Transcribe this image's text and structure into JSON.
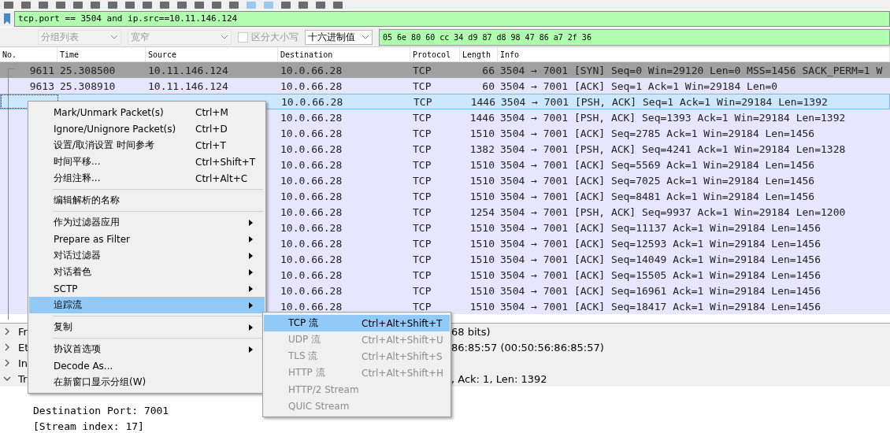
{
  "filter_bar": {
    "value": "tcp.port == 3504 and ip.src==10.11.146.124"
  },
  "search_bar": {
    "scope": {
      "value": "分组列表",
      "disabled": true
    },
    "charset": {
      "value": "宽窄",
      "disabled": true
    },
    "case_sensitive": {
      "label": "区分大小写",
      "checked": false,
      "disabled": true
    },
    "search_type": {
      "value": "十六进制值",
      "disabled": false
    },
    "query": {
      "value": "05 6e 80 60 cc 34 d9 87 d8 98 47 86 a7 2f 36"
    }
  },
  "packet_list": {
    "columns": [
      "No.",
      "Time",
      "Source",
      "Destination",
      "Protocol",
      "Length",
      "Info"
    ],
    "rows": [
      {
        "no": "9611",
        "time": "25.308500",
        "source": "10.11.146.124",
        "destination": "10.0.66.28",
        "protocol": "TCP",
        "length": "66",
        "info": "3504 → 7001 [SYN] Seq=0 Win=29120 Len=0 MSS=1456 SACK_PERM=1 W",
        "color": "#a0a0a0",
        "selected": false
      },
      {
        "no": "9613",
        "time": "25.308910",
        "source": "10.11.146.124",
        "destination": "10.0.66.28",
        "protocol": "TCP",
        "length": "60",
        "info": "3504 → 7001 [ACK] Seq=1 Ack=1 Win=29184 Len=0",
        "color": "#e7e6ff",
        "selected": false
      },
      {
        "destination": "10.0.66.28",
        "protocol": "TCP",
        "length": "1446",
        "info": "3504 → 7001 [PSH, ACK] Seq=1 Ack=1 Win=29184 Len=1392",
        "selected": true
      },
      {
        "destination": "10.0.66.28",
        "protocol": "TCP",
        "length": "1446",
        "info": "3504 → 7001 [PSH, ACK] Seq=1393 Ack=1 Win=29184 Len=1392",
        "color": "#e7e6ff",
        "selected": false
      },
      {
        "destination": "10.0.66.28",
        "protocol": "TCP",
        "length": "1510",
        "info": "3504 → 7001 [ACK] Seq=2785 Ack=1 Win=29184 Len=1456",
        "color": "#e7e6ff",
        "selected": false
      },
      {
        "destination": "10.0.66.28",
        "protocol": "TCP",
        "length": "1382",
        "info": "3504 → 7001 [PSH, ACK] Seq=4241 Ack=1 Win=29184 Len=1328",
        "color": "#e7e6ff",
        "selected": false
      },
      {
        "destination": "10.0.66.28",
        "protocol": "TCP",
        "length": "1510",
        "info": "3504 → 7001 [ACK] Seq=5569 Ack=1 Win=29184 Len=1456",
        "color": "#e7e6ff",
        "selected": false
      },
      {
        "destination": "10.0.66.28",
        "protocol": "TCP",
        "length": "1510",
        "info": "3504 → 7001 [ACK] Seq=7025 Ack=1 Win=29184 Len=1456",
        "color": "#e7e6ff",
        "selected": false
      },
      {
        "destination": "10.0.66.28",
        "protocol": "TCP",
        "length": "1510",
        "info": "3504 → 7001 [ACK] Seq=8481 Ack=1 Win=29184 Len=1456",
        "color": "#e7e6ff",
        "selected": false
      },
      {
        "destination": "10.0.66.28",
        "protocol": "TCP",
        "length": "1254",
        "info": "3504 → 7001 [PSH, ACK] Seq=9937 Ack=1 Win=29184 Len=1200",
        "color": "#e7e6ff",
        "selected": false
      },
      {
        "destination": "10.0.66.28",
        "protocol": "TCP",
        "length": "1510",
        "info": "3504 → 7001 [ACK] Seq=11137 Ack=1 Win=29184 Len=1456",
        "color": "#e7e6ff",
        "selected": false
      },
      {
        "destination": "10.0.66.28",
        "protocol": "TCP",
        "length": "1510",
        "info": "3504 → 7001 [ACK] Seq=12593 Ack=1 Win=29184 Len=1456",
        "color": "#e7e6ff",
        "selected": false
      },
      {
        "destination": "10.0.66.28",
        "protocol": "TCP",
        "length": "1510",
        "info": "3504 → 7001 [ACK] Seq=14049 Ack=1 Win=29184 Len=1456",
        "color": "#e7e6ff",
        "selected": false
      },
      {
        "destination": "10.0.66.28",
        "protocol": "TCP",
        "length": "1510",
        "info": "3504 → 7001 [ACK] Seq=15505 Ack=1 Win=29184 Len=1456",
        "color": "#e7e6ff",
        "selected": false
      },
      {
        "destination": "10.0.66.28",
        "protocol": "TCP",
        "length": "1510",
        "info": "3504 → 7001 [ACK] Seq=16961 Ack=1 Win=29184 Len=1456",
        "color": "#e7e6ff",
        "selected": false
      },
      {
        "destination": "10.0.66.28",
        "protocol": "TCP",
        "length": "1510",
        "info": "3504 → 7001 [ACK] Seq=18417 Ack=1 Win=29184 Len=1456",
        "color": "#e7e6ff",
        "selected": false
      }
    ]
  },
  "packet_details": [
    {
      "text_start": "Fr",
      "text_end": "68 bits)",
      "expanded": false
    },
    {
      "text_start": "Et",
      "text_end": "86:85:57 (00:50:56:86:85:57)",
      "expanded": false
    },
    {
      "text_start": "In",
      "expanded": false
    },
    {
      "text_start": "Tr",
      "text_end": ", Ack: 1, Len: 1392",
      "expanded": true,
      "children": [
        {
          "text_start": "Destination Port: 7001"
        },
        {
          "text_start": "[Stream index: 17]"
        }
      ]
    }
  ],
  "context_menu": {
    "items": [
      {
        "kind": "item",
        "label": "Mark/Unmark Packet(s)",
        "shortcut": "Ctrl+M",
        "submenu": false,
        "selected": false
      },
      {
        "kind": "item",
        "label": "Ignore/Unignore Packet(s)",
        "shortcut": "Ctrl+D",
        "submenu": false,
        "selected": false
      },
      {
        "kind": "item",
        "label": "设置/取消设置 时间参考",
        "shortcut": "Ctrl+T",
        "submenu": false,
        "selected": false
      },
      {
        "kind": "item",
        "label": "时间平移...",
        "shortcut": "Ctrl+Shift+T",
        "submenu": false,
        "selected": false
      },
      {
        "kind": "item",
        "label": "分组注释...",
        "shortcut": "Ctrl+Alt+C",
        "submenu": false,
        "selected": false
      },
      {
        "kind": "separator"
      },
      {
        "kind": "item",
        "label": "编辑解析的名称",
        "submenu": false,
        "selected": false
      },
      {
        "kind": "separator"
      },
      {
        "kind": "item",
        "label": "作为过滤器应用",
        "submenu": true,
        "selected": false
      },
      {
        "kind": "item",
        "label": "Prepare as Filter",
        "submenu": true,
        "selected": false
      },
      {
        "kind": "item",
        "label": "对话过滤器",
        "submenu": true,
        "selected": false
      },
      {
        "kind": "item",
        "label": "对话着色",
        "submenu": true,
        "selected": false
      },
      {
        "kind": "item",
        "label": "SCTP",
        "submenu": true,
        "selected": false
      },
      {
        "kind": "item",
        "label": "追踪流",
        "submenu": true,
        "selected": true
      },
      {
        "kind": "separator"
      },
      {
        "kind": "item",
        "label": "复制",
        "submenu": true,
        "selected": false
      },
      {
        "kind": "separator"
      },
      {
        "kind": "item",
        "label": "协议首选项",
        "submenu": true,
        "selected": false
      },
      {
        "kind": "item",
        "label": "Decode As...",
        "submenu": false,
        "selected": false
      },
      {
        "kind": "item",
        "label": "在新窗口显示分组(W)",
        "submenu": false,
        "selected": false
      }
    ]
  },
  "submenu": {
    "items": [
      {
        "label": "TCP 流",
        "shortcut": "Ctrl+Alt+Shift+T",
        "disabled": false,
        "selected": true
      },
      {
        "label": "UDP 流",
        "shortcut": "Ctrl+Alt+Shift+U",
        "disabled": true,
        "selected": false
      },
      {
        "label": "TLS 流",
        "shortcut": "Ctrl+Alt+Shift+S",
        "disabled": true,
        "selected": false
      },
      {
        "label": "HTTP 流",
        "shortcut": "Ctrl+Alt+Shift+H",
        "disabled": true,
        "selected": false
      },
      {
        "label": "HTTP/2 Stream",
        "disabled": true,
        "selected": false
      },
      {
        "label": "QUIC Stream",
        "disabled": true,
        "selected": false
      }
    ]
  }
}
